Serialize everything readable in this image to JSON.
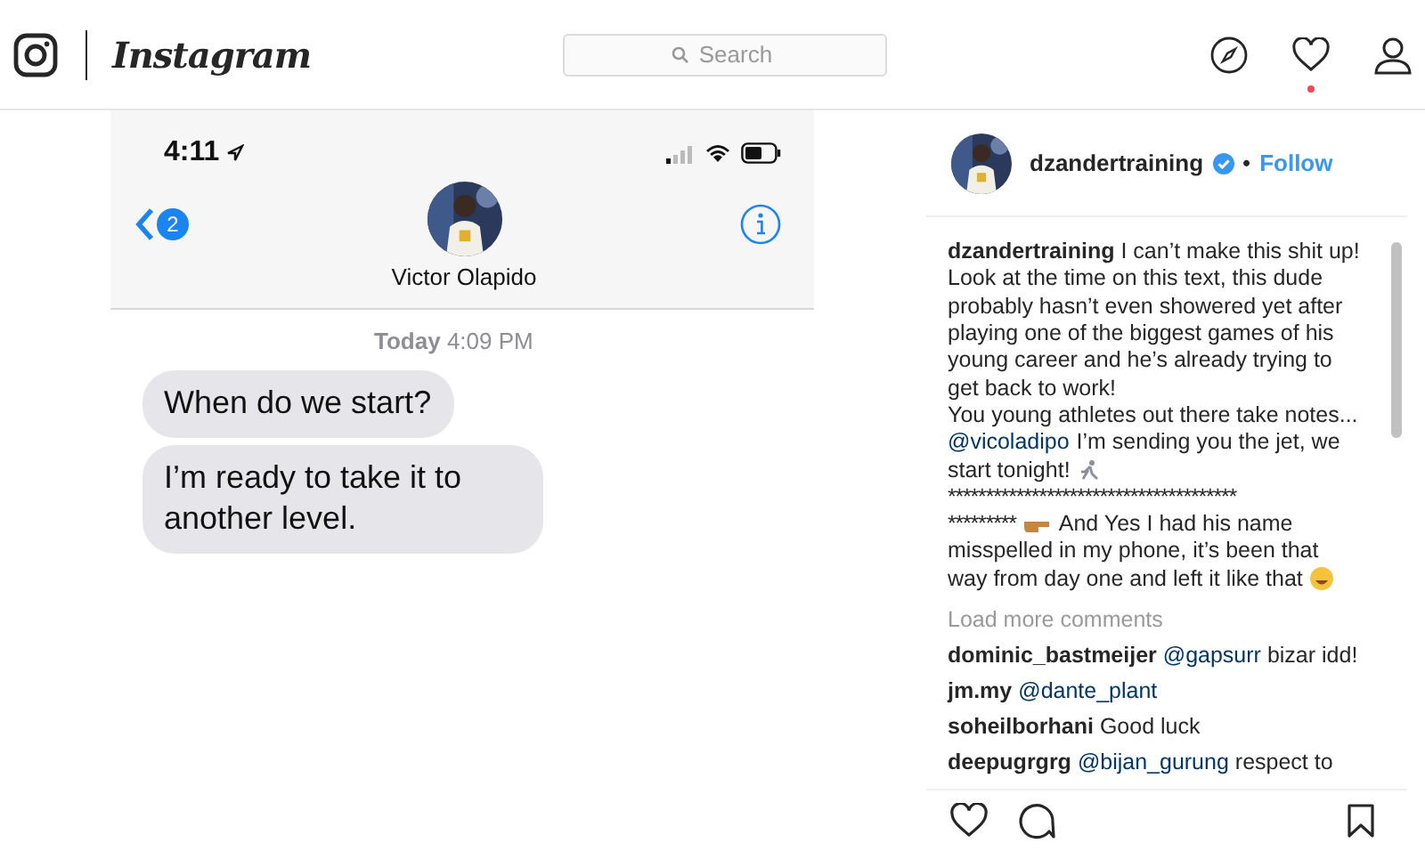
{
  "header": {
    "wordmark": "Instagram",
    "search": {
      "placeholder": "Search"
    },
    "notifications_unread": true
  },
  "post": {
    "screenshot": {
      "status_time": "4:11",
      "back_badge": "2",
      "contact_name": "Victor Olapido",
      "timestamp_day": "Today",
      "timestamp_time": "4:09 PM",
      "messages": [
        "When do we start?",
        "I’m ready to take it to another level."
      ]
    },
    "author": {
      "username": "dzandertraining",
      "verified": true,
      "separator": "•",
      "follow": "Follow"
    },
    "caption": [
      [
        {
          "kind": "text",
          "text": "**dzandertraining** I can’t make this shit up!"
        }
      ],
      [
        {
          "kind": "text",
          "text": "Look at the time on this text, this dude"
        }
      ],
      [
        {
          "kind": "text",
          "text": "probably hasn’t even showered yet after"
        }
      ],
      [
        {
          "kind": "text",
          "text": "playing one of the biggest games of his"
        }
      ],
      [
        {
          "kind": "text",
          "text": "young career and he’s already trying to"
        }
      ],
      [
        {
          "kind": "text",
          "text": "get back to work!"
        }
      ],
      [
        {
          "kind": "text",
          "text": "You young athletes out there take notes..."
        }
      ],
      [
        {
          "kind": "mention",
          "text": "@vicoladipo"
        },
        {
          "kind": "text",
          "text": "I’m sending you the jet, we"
        }
      ],
      [
        {
          "kind": "text",
          "text": "start tonight!"
        },
        {
          "kind": "runner"
        }
      ],
      [
        {
          "kind": "stars",
          "text": "**************************************"
        }
      ],
      [
        {
          "kind": "stars",
          "text": "*********"
        },
        {
          "kind": "pointing"
        },
        {
          "kind": "text",
          "text": "And Yes I had his name"
        }
      ],
      [
        {
          "kind": "text",
          "text": "misspelled in my phone, it’s been that"
        }
      ],
      [
        {
          "kind": "text",
          "text": "way from day one and left it like that"
        },
        {
          "kind": "laughing"
        }
      ]
    ],
    "load_more": "Load more comments",
    "comments": [
      {
        "user": "dominic_bastmeijer",
        "mention": "@gapsurr",
        "text": "bizar idd!"
      },
      {
        "user": "jm.my",
        "mention": "@dante_plant"
      },
      {
        "user": "soheilborhani",
        "text": "Good luck"
      },
      {
        "user": "deepugrgrg",
        "mention": "@bijan_gurung",
        "text": "respect to"
      }
    ]
  }
}
